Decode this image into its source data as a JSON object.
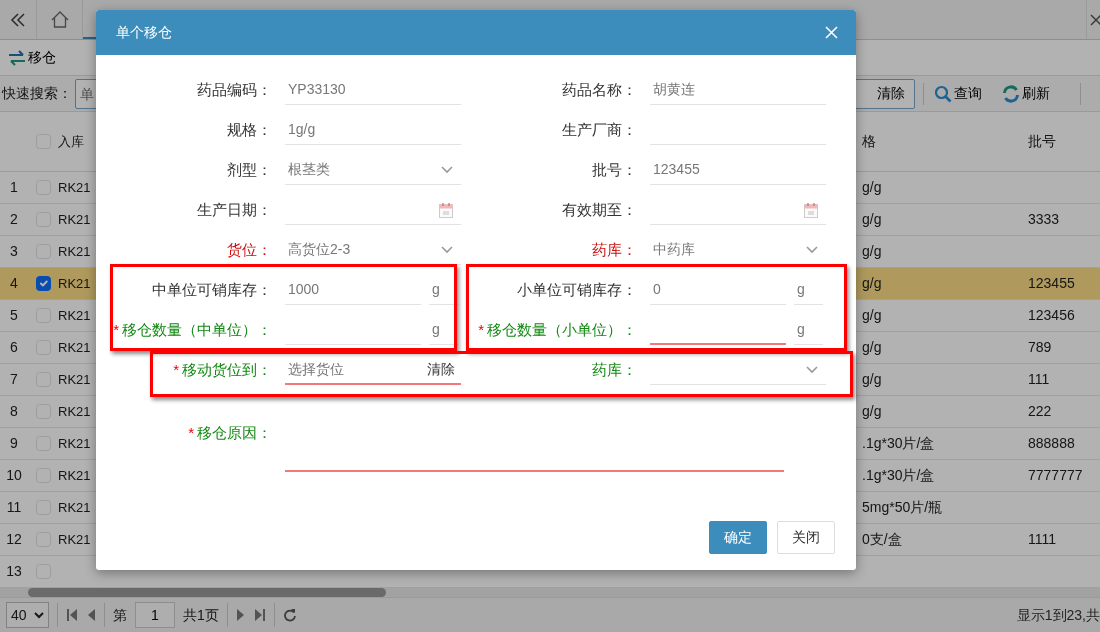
{
  "toolbar": {
    "buttons": [
      {
        "label": "移仓"
      }
    ]
  },
  "search": {
    "label": "快速搜索：",
    "placeholder": "单",
    "clear": "清除",
    "buttons": [
      {
        "kind": "search",
        "label": "查询"
      },
      {
        "kind": "refresh",
        "label": "刷新"
      }
    ]
  },
  "table": {
    "header_checked": false,
    "columns": [
      "入库",
      "格",
      "批号"
    ],
    "rows": [
      {
        "number": "1",
        "selected": false,
        "column_1": "RK21",
        "spec": "g/g"
      },
      {
        "number": "2",
        "selected": false,
        "column_1": "RK21",
        "spec": "g/g",
        "batch": "3333"
      },
      {
        "number": "3",
        "selected": false,
        "column_1": "RK21",
        "spec": "g/g"
      },
      {
        "number": "4",
        "selected": true,
        "column_1": "RK21",
        "spec": "g/g",
        "batch": "123455"
      },
      {
        "number": "5",
        "selected": false,
        "column_1": "RK21",
        "spec": "g/g",
        "batch": "123456"
      },
      {
        "number": "6",
        "selected": false,
        "column_1": "RK21",
        "spec": "g/g",
        "batch": "789"
      },
      {
        "number": "7",
        "selected": false,
        "column_1": "RK21",
        "spec": "g/g",
        "batch": "111"
      },
      {
        "number": "8",
        "selected": false,
        "column_1": "RK21",
        "spec": "g/g",
        "batch": "222"
      },
      {
        "number": "9",
        "selected": false,
        "column_1": "RK21",
        "spec": ".1g*30片/盒",
        "batch": "888888"
      },
      {
        "number": "10",
        "selected": false,
        "column_1": "RK21",
        "spec": ".1g*30片/盒",
        "batch": "7777777"
      },
      {
        "number": "11",
        "selected": false,
        "column_1": "RK21",
        "spec": "5mg*50片/瓶"
      },
      {
        "number": "12",
        "selected": false,
        "column_1": "RK21",
        "spec": "0支/盒",
        "batch": "1111"
      },
      {
        "number": "13",
        "selected": false
      }
    ]
  },
  "pager": {
    "page_size": "40",
    "page_label": "第",
    "page": "1",
    "total_pages": "共1页",
    "summary": "显示1到23,共"
  },
  "dialog": {
    "title": "单个移仓",
    "rows": [
      [
        {
          "label": "药品编码：",
          "color": "#333333",
          "kind": "text",
          "value": "YP33130",
          "invalid": false
        },
        {
          "label": "药品名称：",
          "color": "#333333",
          "kind": "text",
          "value": "胡黄连",
          "invalid": false
        }
      ],
      [
        {
          "label": "规格：",
          "color": "#333333",
          "kind": "text",
          "value": "1g/g",
          "invalid": false
        },
        {
          "label": "生产厂商：",
          "color": "#333333",
          "kind": "text",
          "invalid": false
        }
      ],
      [
        {
          "label": "剂型：",
          "color": "#333333",
          "kind": "select",
          "value": "根茎类",
          "invalid": false
        },
        {
          "label": "批号：",
          "color": "#333333",
          "kind": "text",
          "value": "123455",
          "invalid": false
        }
      ],
      [
        {
          "label": "生产日期：",
          "color": "#333333",
          "kind": "date",
          "invalid": false
        },
        {
          "label": "有效期至：",
          "color": "#333333",
          "kind": "date",
          "invalid": false
        }
      ],
      [
        {
          "label": "货位：",
          "color": "#cc1111",
          "kind": "select",
          "value": "高货位2-3",
          "invalid": false
        },
        {
          "label": "药库：",
          "color": "#cc1111",
          "kind": "select",
          "value": "中药库",
          "invalid": false
        }
      ],
      [
        {
          "label": "中单位可销库存：",
          "color": "#333333",
          "kind": "unit",
          "value": "1000",
          "unit": "g",
          "invalid": false
        },
        {
          "label": "小单位可销库存：",
          "color": "#333333",
          "kind": "unit",
          "value": "0",
          "unit": "g",
          "invalid": false
        }
      ],
      [
        {
          "label": "移仓数量（中单位）：",
          "mark": "*",
          "color": "#118811",
          "kind": "unit",
          "unit": "g",
          "invalid": false
        },
        {
          "label": "移仓数量（小单位）：",
          "mark": "*",
          "color": "#118811",
          "kind": "unit",
          "unit": "g",
          "invalid": true
        }
      ],
      [
        {
          "label": "移动货位到：",
          "mark": "*",
          "color": "#118811",
          "kind": "picker",
          "placeholder": "选择货位",
          "clear": "清除",
          "invalid": true
        },
        {
          "label": "药库：",
          "color": "#118811",
          "kind": "select",
          "invalid": false
        }
      ]
    ],
    "reason": {
      "label": "移仓原因：",
      "mark": "*",
      "color": "#118811",
      "kind": "textarea",
      "invalid": true
    },
    "buttons": [
      {
        "label": "确定",
        "primary": true
      },
      {
        "label": "关闭",
        "primary": false
      }
    ]
  }
}
